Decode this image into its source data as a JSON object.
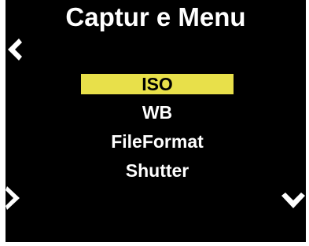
{
  "screen": {
    "title": "Captur e Menu",
    "background_color": "#000000",
    "highlight_color": "#e8e04a"
  },
  "menu": {
    "items": [
      {
        "label": "ISO",
        "selected": true
      },
      {
        "label": "WB",
        "selected": false
      },
      {
        "label": "FileFormat",
        "selected": false
      },
      {
        "label": "Shutter",
        "selected": false
      }
    ]
  },
  "nav": {
    "back_icon": "chevron-left-icon",
    "enter_icon": "chevron-right-icon",
    "down_icon": "chevron-down-icon"
  }
}
